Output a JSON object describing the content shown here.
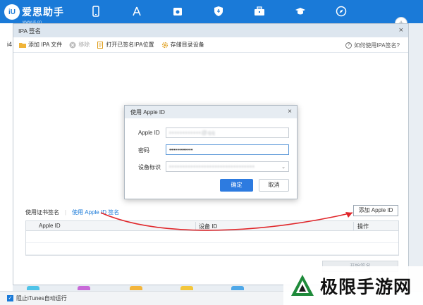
{
  "app": {
    "logo_text": "爱思助手",
    "logo_mark": "iU",
    "logo_sub": "www.i4.cn",
    "side_label": "i4",
    "nav_icons": [
      "phone-icon",
      "app-store-icon",
      "music-icon",
      "ringtone-icon",
      "toolbox-icon",
      "tutorial-icon",
      "compass-icon"
    ],
    "plus_label": "+"
  },
  "ipa_dialog": {
    "title": "IPA 签名",
    "close": "×",
    "toolbar": {
      "add_ipa": "添加 IPA 文件",
      "remove": "移除",
      "open_signed": "打开已签名IPA位置",
      "storage_device": "存储目录设备",
      "help": "如何使用IPA签名?"
    },
    "tabs": {
      "cert_sign": "使用证书签名",
      "separator": "|",
      "apple_id_sign": "使用 Apple ID 签名"
    },
    "add_apple_id_button": "添加 Apple ID",
    "table": {
      "columns": [
        "Apple ID",
        "设备 ID",
        "操作"
      ]
    },
    "start_sign_button": "开始签名"
  },
  "apple_id_modal": {
    "title": "使用 Apple ID",
    "close": "×",
    "apple_id_label": "Apple ID",
    "apple_id_value": "••••••••••••@qq",
    "password_label": "密码",
    "password_value": "••••••••••••",
    "device_label": "设备标识",
    "device_value": "••••••••••••••••••••••••••••••••",
    "confirm": "确定",
    "cancel": "取消"
  },
  "bottom_bar": {
    "checkbox_label": "阻止iTunes自动运行",
    "checked": true
  },
  "watermark": {
    "text": "极限手游网"
  },
  "colors": {
    "brand_blue": "#1a7ad8",
    "arrow_red": "#e0262a",
    "primary_button": "#2d7be0"
  }
}
